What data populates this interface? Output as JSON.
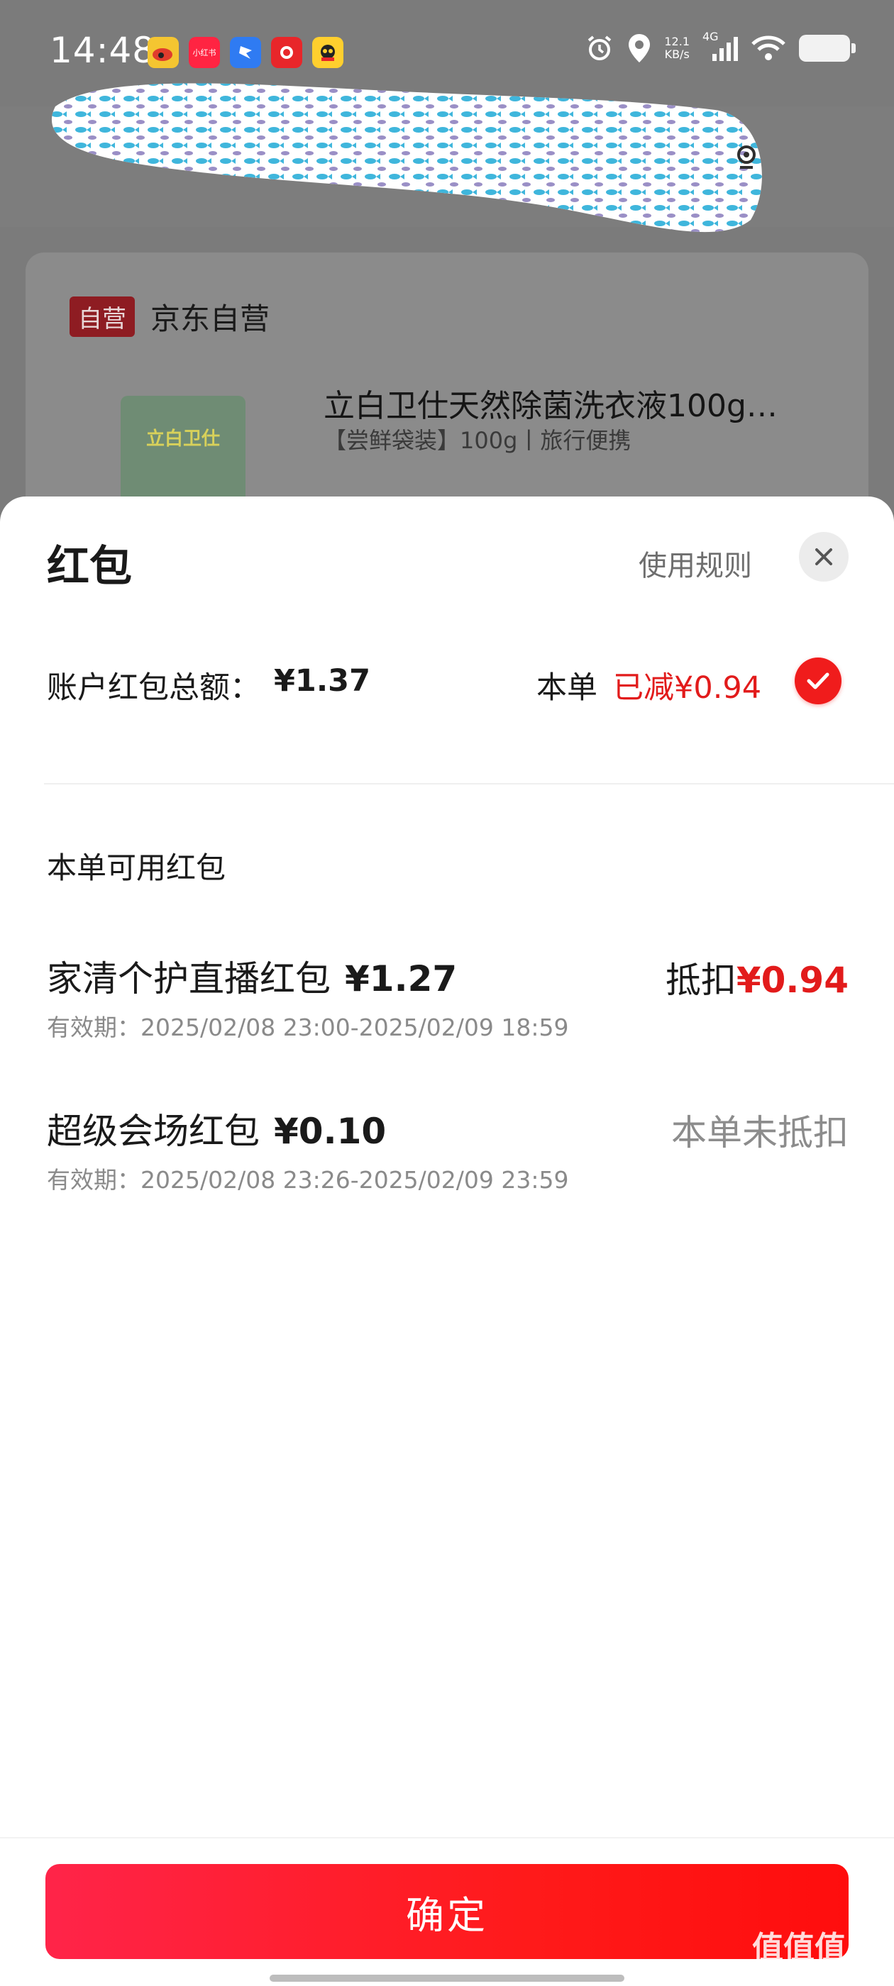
{
  "status_bar": {
    "time": "14:48",
    "net_speed": "12.1\nKB/s",
    "network": "4G",
    "app_icons": [
      "weibo-icon",
      "xiaohongshu-icon",
      "dingtalk-icon",
      "app-red-icon",
      "app-yellow-icon"
    ],
    "xiaohongshu_label": "小红书"
  },
  "background_page": {
    "self_badge": "自营",
    "store_name": "京东自营",
    "product_title": "立白卫仕天然除菌洗衣液100g…",
    "product_spec": "【尝鲜袋装】100g丨旅行便携",
    "thumb_brand": "立白卫仕"
  },
  "sheet": {
    "title": "红包",
    "rules_link": "使用规则",
    "total_label": "账户红包总额：",
    "total_amount": "¥1.37",
    "order_label": "本单",
    "order_discount": "已减¥0.94",
    "section_title": "本单可用红包",
    "coupons": [
      {
        "name": "家清个护直播红包",
        "value": "¥1.27",
        "validity": "有效期：2025/02/08 23:00-2025/02/09 18:59",
        "deduct_label": "抵扣",
        "deduct_amount": "¥0.94"
      },
      {
        "name": "超级会场红包",
        "value": "¥0.10",
        "validity": "有效期：2025/02/08 23:26-2025/02/09 23:59",
        "status": "本单未抵扣"
      }
    ],
    "confirm_label": "确定"
  },
  "watermark": {
    "text": "值值值",
    "url": "zhizhizhi.com"
  },
  "colors": {
    "accent_red": "#e21b1b",
    "button_red": "#ff1a1a",
    "dim_overlay": "#7b7b7b"
  }
}
